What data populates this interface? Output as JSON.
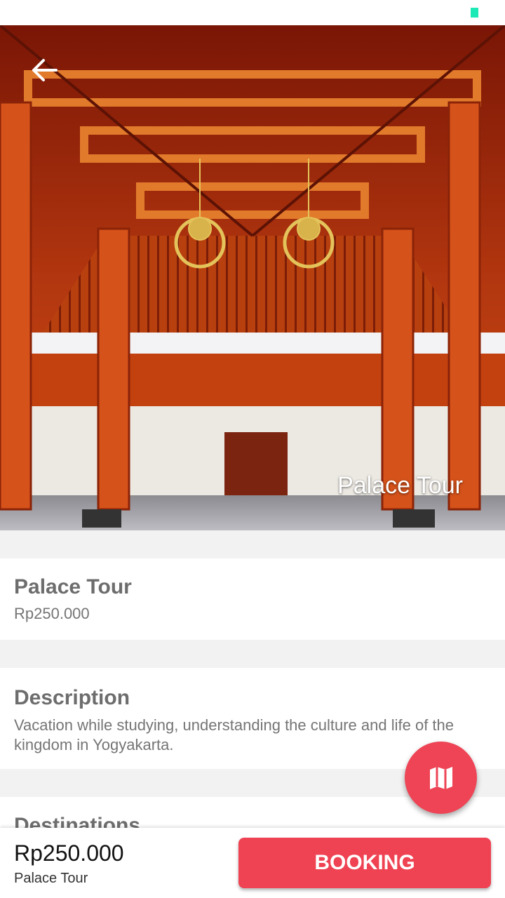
{
  "hero": {
    "title": "Palace Tour",
    "image_description": "Traditional Javanese pavilion with carved red wooden ceiling and chandeliers"
  },
  "header": {
    "back_icon": "arrow-left-icon"
  },
  "info": {
    "title": "Palace Tour",
    "price": "Rp250.000"
  },
  "description": {
    "heading": "Description",
    "text": "Vacation while studying, understanding the culture and life of the kingdom in Yogyakarta."
  },
  "destinations": {
    "heading": "Destinations"
  },
  "fab": {
    "icon": "map-icon"
  },
  "bottom_bar": {
    "price": "Rp250.000",
    "name": "Palace Tour",
    "booking_label": "BOOKING"
  },
  "colors": {
    "accent": "#ef4252",
    "status_indicator": "#1de9b6"
  }
}
